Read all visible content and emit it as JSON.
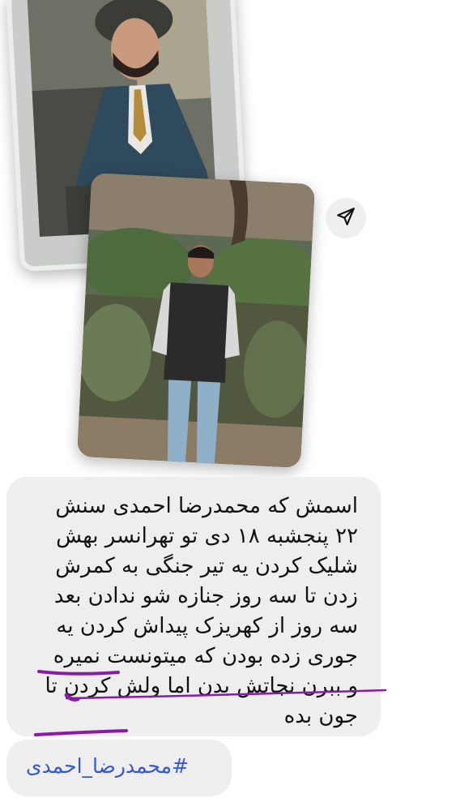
{
  "message": {
    "text": "اسمش که محمدرضا احمدی سنش\n۲۲ پنجشبه ۱۸ دی تو تهرانسر بهش\nشلیک کردن یه تیر جنگی به کمرش\nزدن تا سه روز جنازه شو ندادن بعد\nسه روز از کهریزک پیداش کردن یه\nجوری زده بودن که میتونست نمیره\nو ببرن نجاتش بدن اما ولش کردن تا\nجون بده",
    "hashtag": "#محمدرضا_احمدی"
  },
  "photos": [
    {
      "name": "portrait-photo"
    },
    {
      "name": "outdoor-photo"
    }
  ],
  "icons": {
    "send": "send-icon"
  },
  "colors": {
    "bubble": "#eeeeee",
    "hashtag": "#3758d6",
    "scribble": "#8a1aa8"
  }
}
